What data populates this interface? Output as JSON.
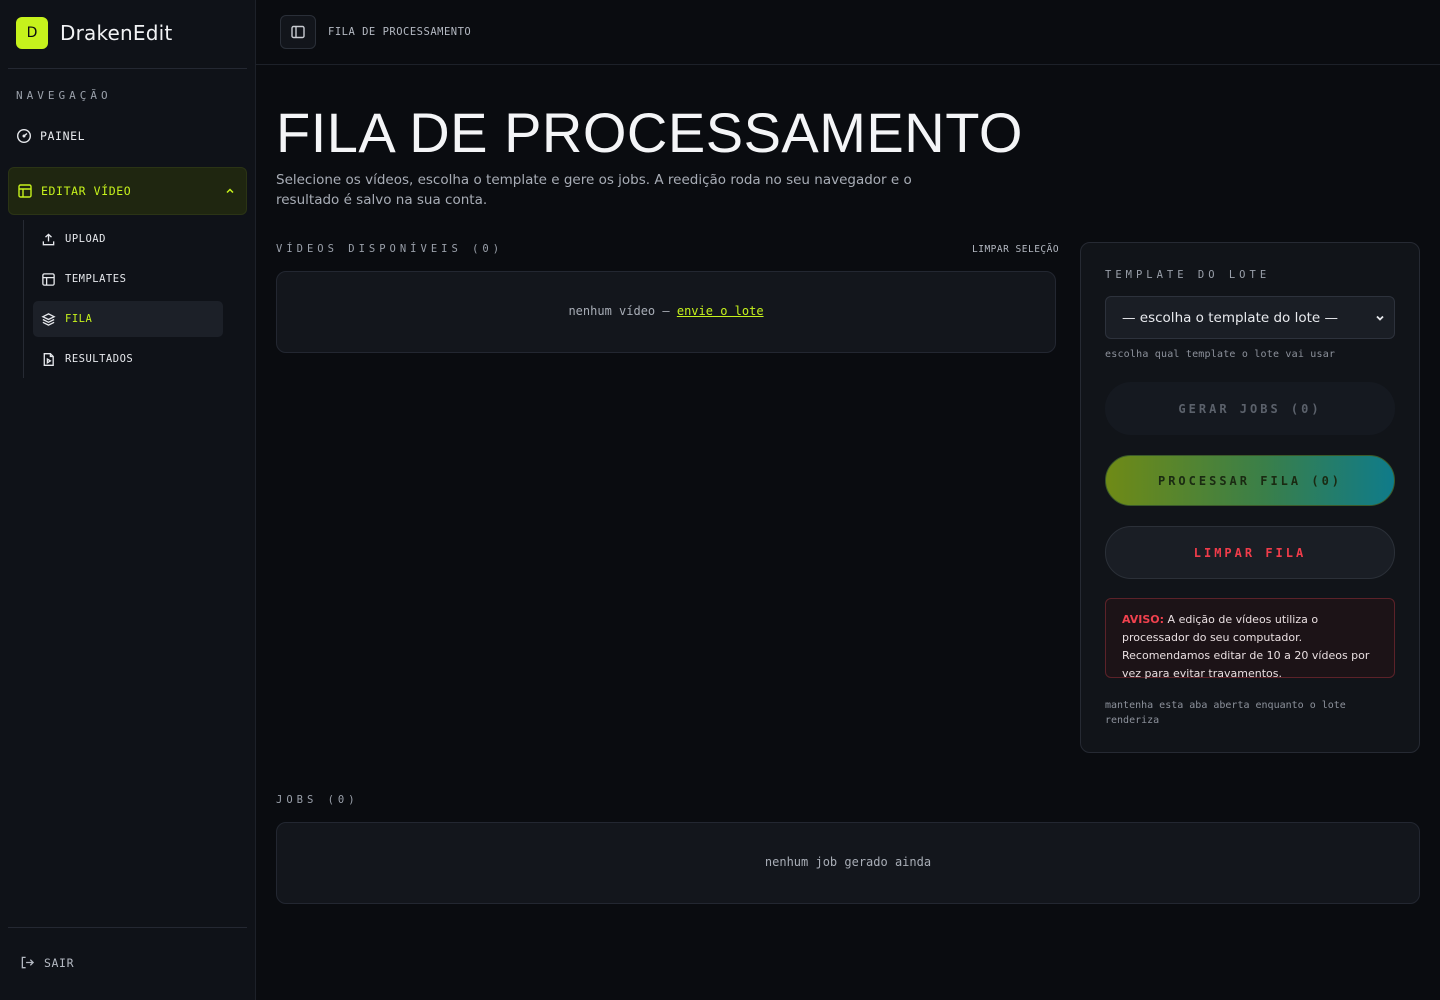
{
  "brand": {
    "logo_letter": "D",
    "name": "DrakenEdit",
    "accent": "#c6f21c"
  },
  "sidebar": {
    "heading": "NAVEGAÇÃO",
    "painel": "PAINEL",
    "group": "EDITAR VÍDEO",
    "sub_items": [
      {
        "label": "UPLOAD",
        "icon": "upload-icon"
      },
      {
        "label": "TEMPLATES",
        "icon": "layout-icon"
      },
      {
        "label": "FILA",
        "icon": "layers-icon",
        "active": true
      },
      {
        "label": "RESULTADOS",
        "icon": "file-video-icon"
      }
    ],
    "logout": "SAIR"
  },
  "topbar": {
    "breadcrumb": "FILA DE PROCESSAMENTO"
  },
  "main": {
    "title": "FILA DE PROCESSAMENTO",
    "subtitle": "Selecione os vídeos, escolha o template e gere os jobs. A reedição roda no seu navegador e o resultado é salvo na sua conta.",
    "videos_label": "VÍDEOS DISPONÍVEIS (0)",
    "clear_selection": "LIMPAR SELEÇÃO",
    "videos_empty_prefix": "nenhum vídeo —",
    "videos_empty_link": "envie o lote",
    "jobs_label": "JOBS (0)",
    "jobs_empty": "nenhum job gerado ainda"
  },
  "card": {
    "label": "TEMPLATE DO LOTE",
    "select_value": "— escolha o template do lote —",
    "select_hint": "escolha qual template o lote vai usar",
    "generate": "GERAR JOBS (0)",
    "process": "PROCESSAR FILA (0)",
    "clear": "LIMPAR FILA",
    "warning_label": "AVISO:",
    "warning_text": "A edição de vídeos utiliza o processador do seu computador. Recomendamos editar de 10 a 20 vídeos por vez para evitar travamentos.",
    "keep_open": "mantenha esta aba aberta enquanto o lote renderiza"
  }
}
